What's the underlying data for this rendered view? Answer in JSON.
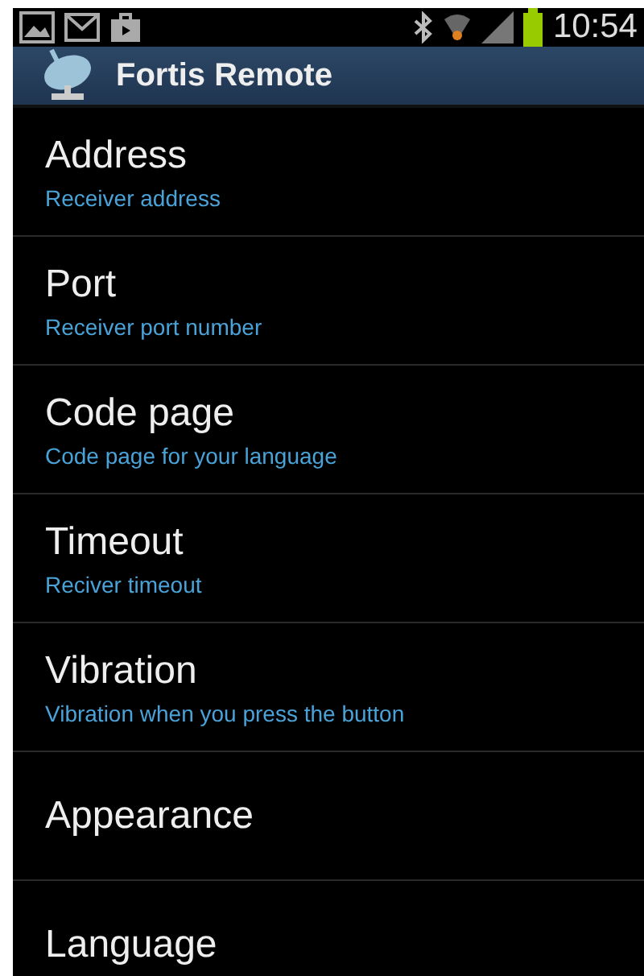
{
  "status_bar": {
    "time": "10:54"
  },
  "action_bar": {
    "title": "Fortis Remote"
  },
  "preferences": [
    {
      "title": "Address",
      "summary": "Receiver address"
    },
    {
      "title": "Port",
      "summary": "Receiver port number"
    },
    {
      "title": "Code page",
      "summary": "Code page for your language"
    },
    {
      "title": "Timeout",
      "summary": "Reciver timeout"
    },
    {
      "title": "Vibration",
      "summary": "Vibration when you press the button"
    },
    {
      "title": "Appearance"
    },
    {
      "title": "Language"
    }
  ]
}
